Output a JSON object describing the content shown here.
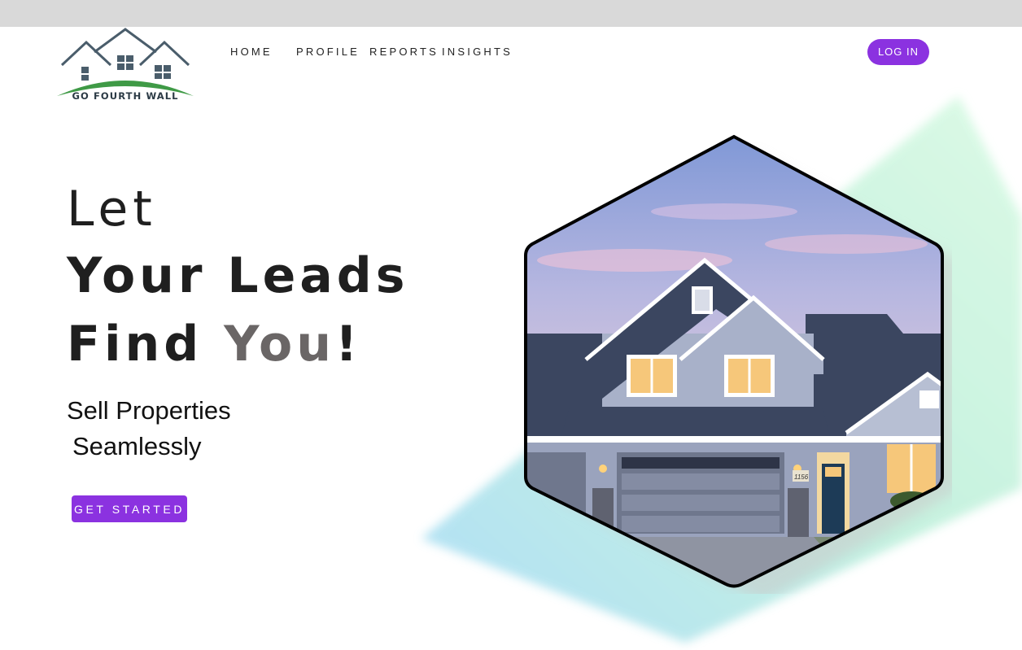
{
  "brand": {
    "name": "GO FOURTH WALL"
  },
  "nav": {
    "items": [
      "HOME",
      "PROFILE",
      "REPORTS",
      "INSIGHTS"
    ]
  },
  "header": {
    "login_label": "LOG IN"
  },
  "hero": {
    "line1": "Let",
    "line2": "Your Leads",
    "line3_a": "Find ",
    "line3_b": "You",
    "line3_c": "!",
    "subtitle_line1": "Sell Properties",
    "subtitle_line2": "Seamlessly",
    "cta_label": "GET STARTED",
    "house_number": "1156"
  },
  "colors": {
    "accent": "#8b32e0",
    "topbar": "#d9d9d9",
    "roof": "#3b4660",
    "siding": "#a8b1c9"
  }
}
